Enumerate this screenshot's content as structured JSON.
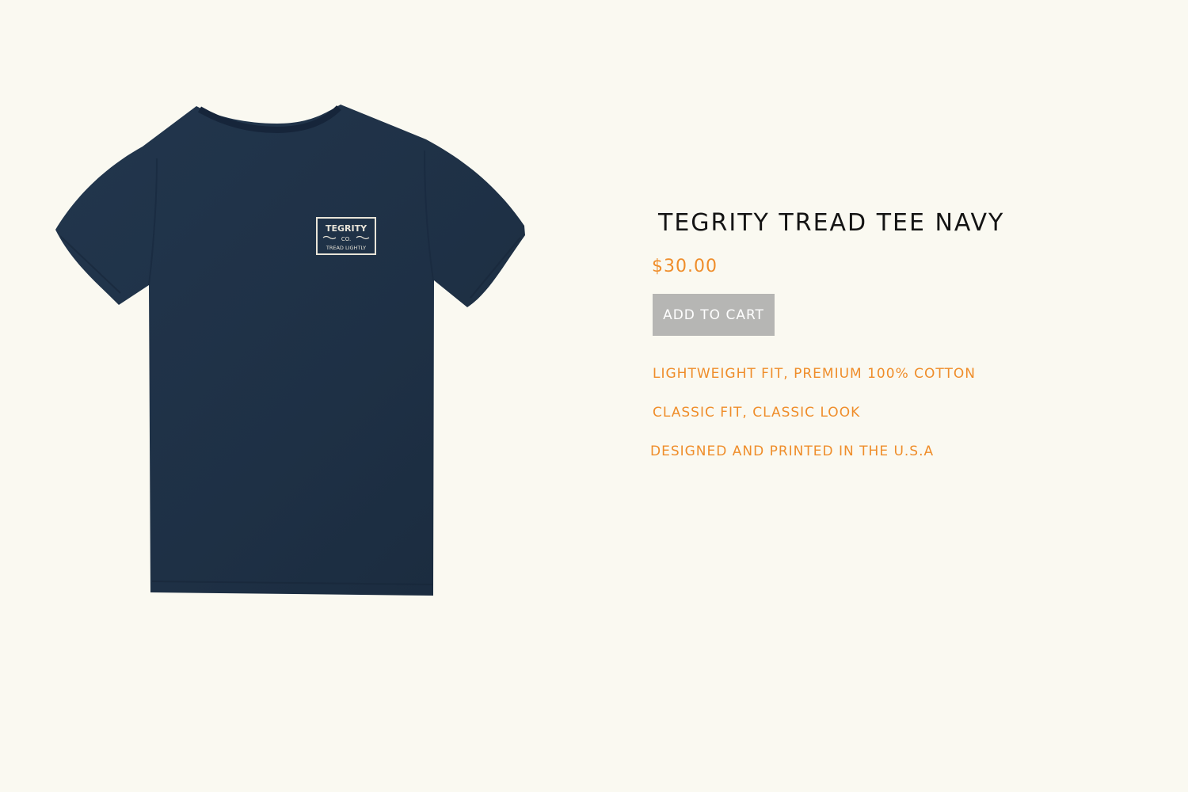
{
  "product": {
    "title": "TEGRITY TREAD TEE NAVY",
    "price": "$30.00",
    "add_to_cart_label": "ADD TO CART",
    "features": [
      "LIGHTWEIGHT FIT, PREMIUM 100% COTTON",
      "CLASSIC FIT, CLASSIC LOOK",
      "DESIGNED AND PRINTED IN THE U.S.A"
    ],
    "image": {
      "shirt_color": "#1f3146",
      "logo_text": [
        "TEGRITY",
        "CO.",
        "TREAD LIGHTLY"
      ]
    }
  },
  "colors": {
    "background": "#faf9f1",
    "accent": "#ef8d2a",
    "title": "#141414",
    "button_bg": "#b6b6b4",
    "button_text": "#ffffff"
  }
}
